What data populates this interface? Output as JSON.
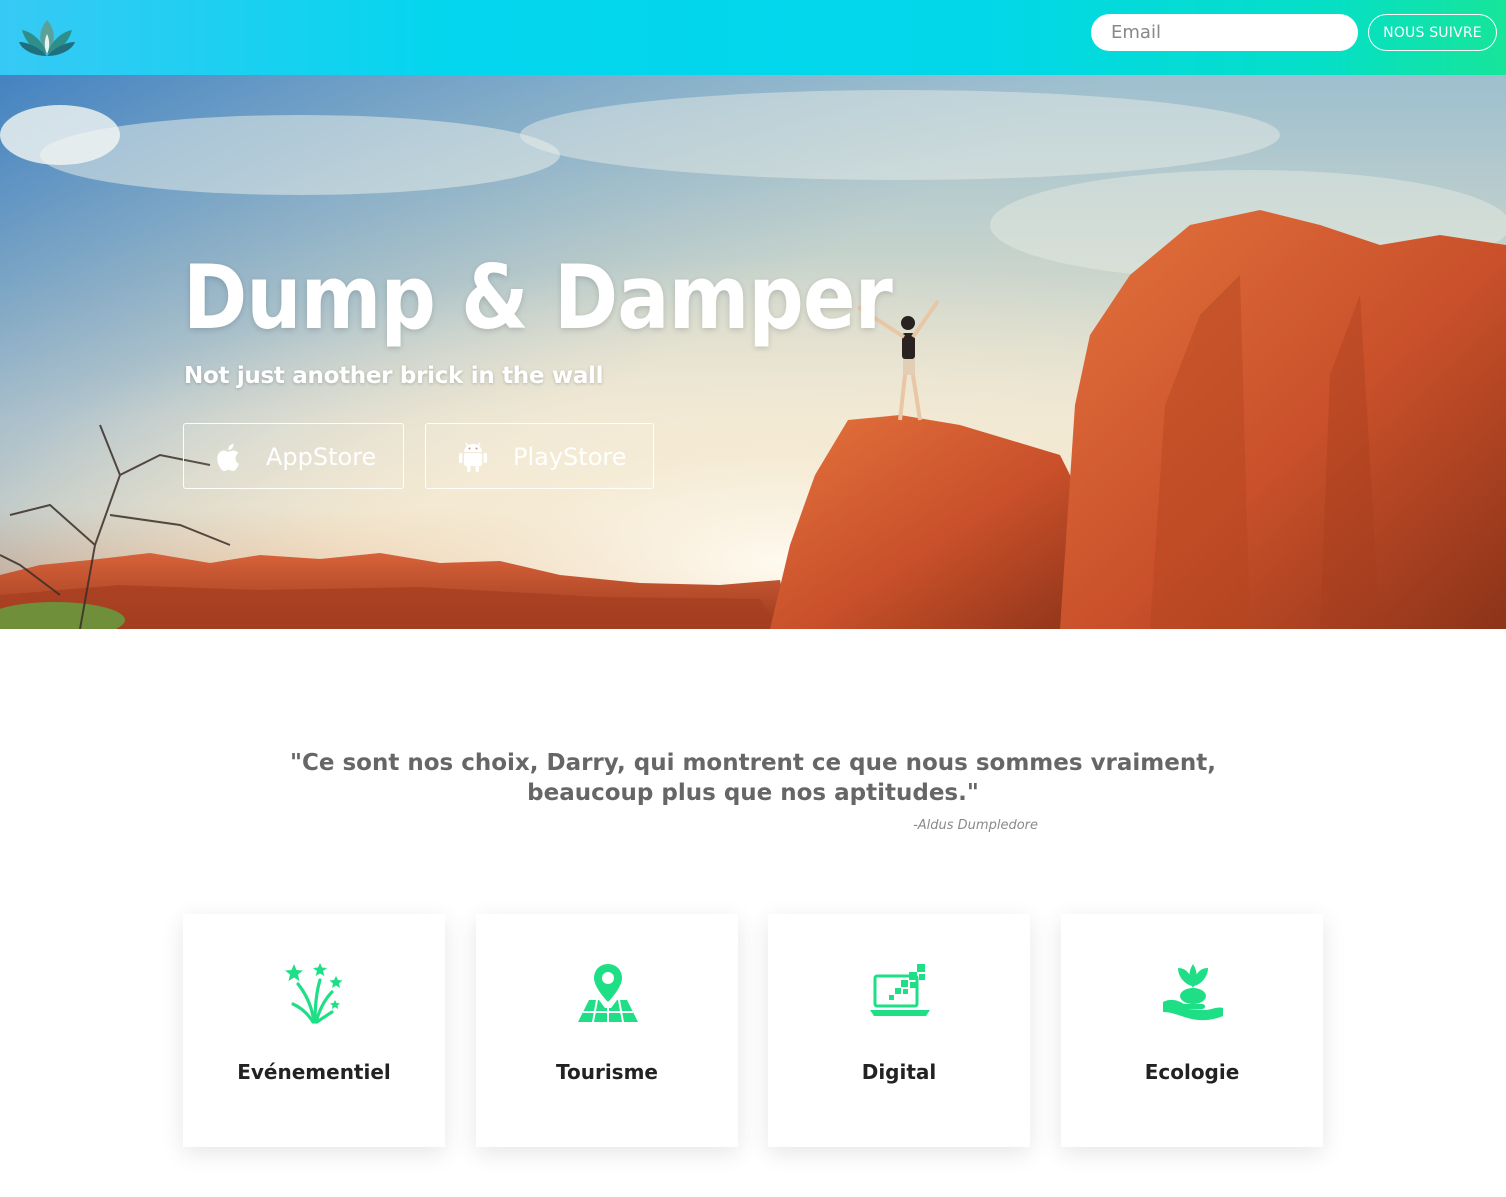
{
  "header": {
    "logo": "lotus-logo",
    "email_placeholder": "Email",
    "follow_label": "NOUS SUIVRE"
  },
  "hero": {
    "title": "Dump & Damper",
    "subtitle": "Not just another brick in the wall",
    "appstore": {
      "label": "AppStore",
      "icon": "apple-icon"
    },
    "playstore": {
      "label": "PlayStore",
      "icon": "android-icon"
    }
  },
  "quote": {
    "line1": "\"Ce sont nos choix, Darry, qui montrent ce que nous sommes vraiment,",
    "line2": "beaucoup plus que nos aptitudes.\"",
    "author": "-Aldus Dumpledore"
  },
  "services": [
    {
      "label": "Evénementiel",
      "icon": "fireworks-icon"
    },
    {
      "label": "Tourisme",
      "icon": "map-pin-icon"
    },
    {
      "label": "Digital",
      "icon": "laptop-pixels-icon"
    },
    {
      "label": "Ecologie",
      "icon": "plant-hand-icon"
    }
  ],
  "colors": {
    "header_gradient_start": "#37c9f5",
    "header_gradient_mid": "#02d7ea",
    "header_gradient_end": "#17e59a",
    "icon_accent": "#1fdf86",
    "quote_text": "#666666",
    "card_text": "#222222"
  }
}
